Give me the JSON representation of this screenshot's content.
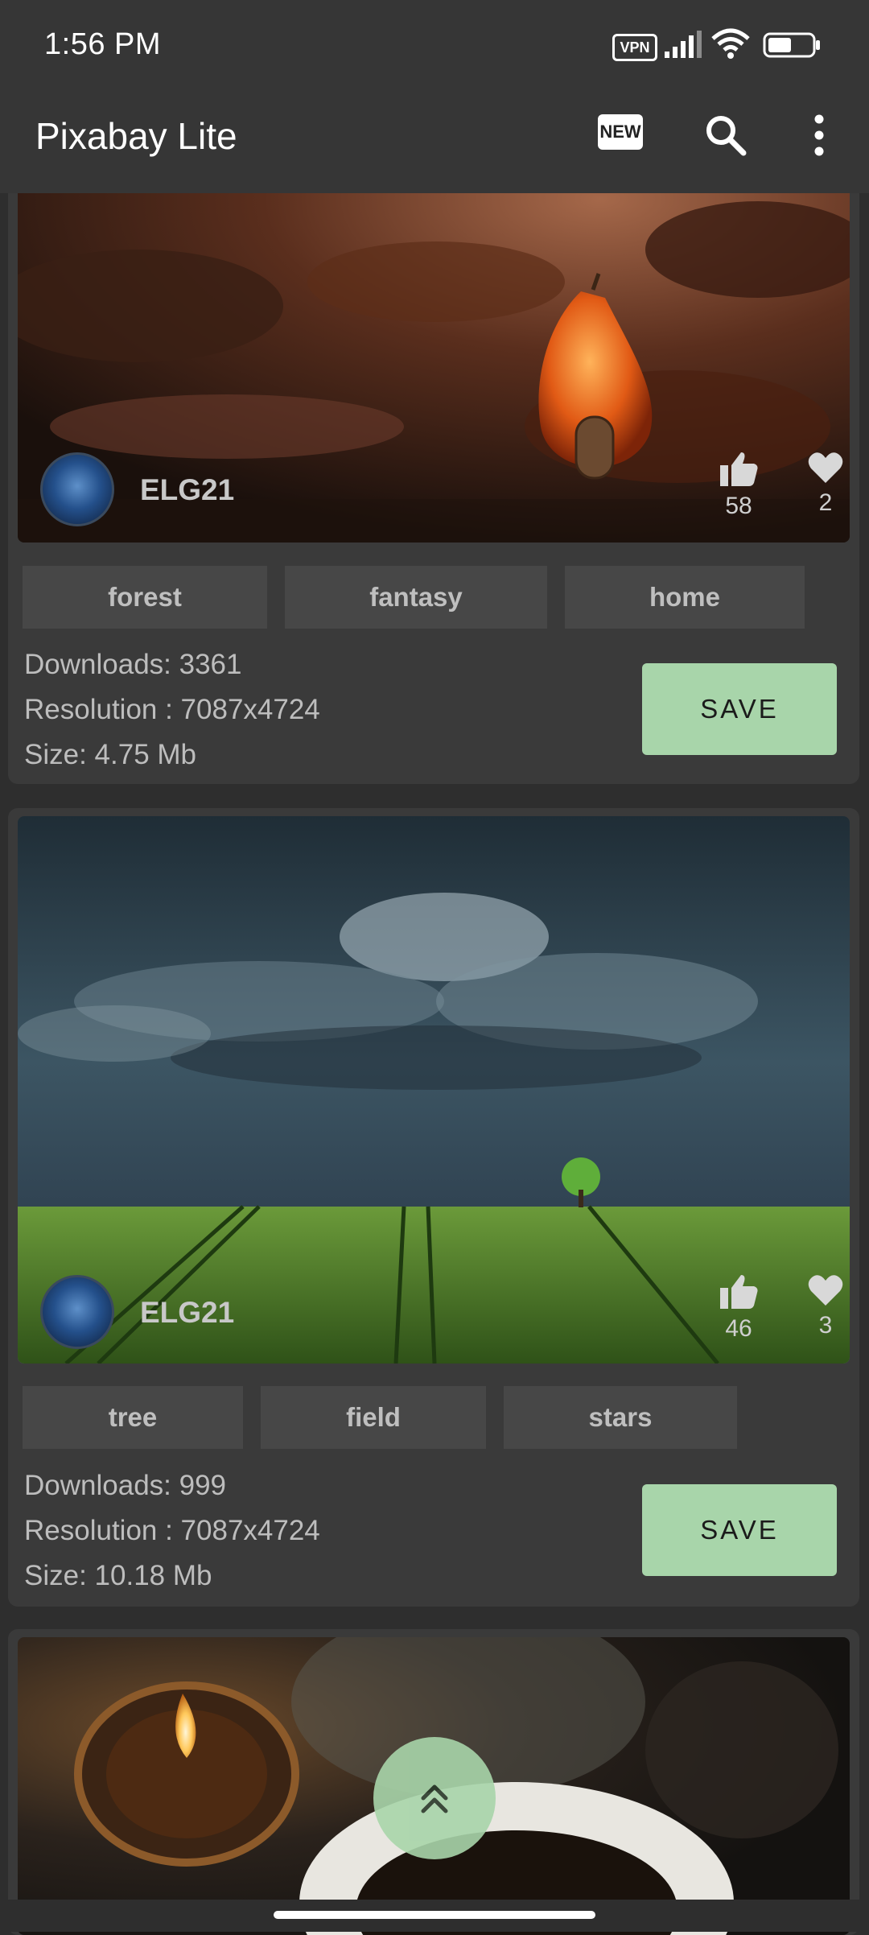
{
  "status_bar": {
    "time": "1:56 PM",
    "vpn": "VPN"
  },
  "app_bar": {
    "title": "Pixabay Lite",
    "new_badge": "NEW"
  },
  "cards": [
    {
      "author": "ELG21",
      "likes": "58",
      "favorites": "2",
      "tags": [
        "forest",
        "fantasy",
        "home"
      ],
      "downloads": "Downloads: 3361",
      "resolution": "Resolution : 7087x4724",
      "size": "Size: 4.75 Mb",
      "save_label": "SAVE"
    },
    {
      "author": "ELG21",
      "likes": "46",
      "favorites": "3",
      "tags": [
        "tree",
        "field",
        "stars"
      ],
      "downloads": "Downloads: 999",
      "resolution": "Resolution : 7087x4724",
      "size": "Size: 10.18 Mb",
      "save_label": "SAVE"
    }
  ],
  "colors": {
    "accent": "#a8d5aa",
    "background": "#2e2e2e",
    "card": "#3a3a3a",
    "tag": "#474747"
  }
}
